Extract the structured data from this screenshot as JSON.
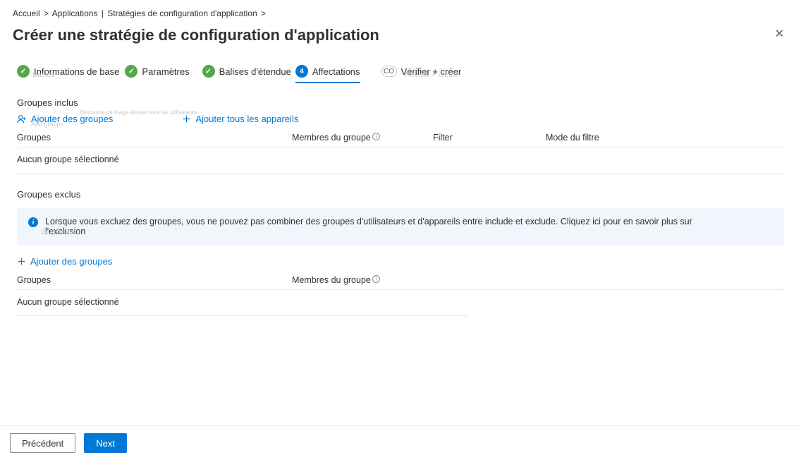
{
  "breadcrumb": {
    "home": "Accueil",
    "sep": "&gt;",
    "apps": "Applications",
    "mid": "|",
    "policies": "Stratégies de configuration d'application",
    "tail": "&gt;"
  },
  "header": {
    "title": "Créer une stratégie de configuration d'application"
  },
  "tabs": {
    "basics": "Informations de base",
    "basics_ghost": "Basics",
    "settings": "Paramètres",
    "scope": "Balises d'étendue",
    "assign_num": "4",
    "assign": "Affectations",
    "review_code": "CO",
    "review": "Vérifier + créer",
    "review_ghost": "Review + create"
  },
  "included": {
    "title": "Groupes inclus",
    "add_groups": "Ajouter des groupes",
    "add_groups_ghost_top": "Demande de tirage Ajouter tous les utilisateurs",
    "add_groups_ghost_bot": "Add groups",
    "add_all_devices": "Ajouter tous les appareils",
    "cols": {
      "groups": "Groupes",
      "members": "Membres du groupe",
      "filter": "Filter",
      "filter_mode": "Mode du filtre"
    },
    "empty": "Aucun groupe sélectionné"
  },
  "excluded": {
    "title": "Groupes exclus",
    "info": "Lorsque vous excluez des groupes, vous ne pouvez pas combiner des groupes d'utilisateurs et d'appareils entre include et exclude. Cliquez ici pour en savoir plus sur l'exclusion",
    "info_link_ghost": "de groupes.",
    "add_groups": "Ajouter des groupes",
    "cols": {
      "groups": "Groupes",
      "members": "Membres du groupe"
    },
    "empty": "Aucun groupe sélectionné"
  },
  "footer": {
    "previous": "Précédent",
    "next": "Next"
  }
}
